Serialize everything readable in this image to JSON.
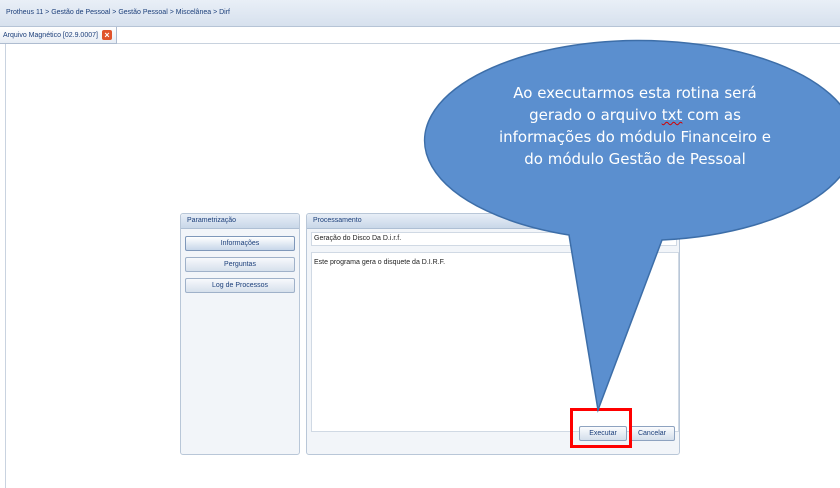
{
  "breadcrumb": "Protheus 11 > Gestão de Pessoal > Gestão Pessoal > Miscelânea > Dirf",
  "tab": {
    "label": "Arquivo Magnético [02.9.0007]",
    "close_glyph": "×"
  },
  "parametrizacao": {
    "title": "Parametrização",
    "buttons": [
      "Informações",
      "Perguntas",
      "Log de Processos"
    ]
  },
  "processamento": {
    "title": "Processamento",
    "field_title": "Geração do Disco Da D.i.r.f.",
    "description": "Este programa gera o disquete da D.I.R.F.",
    "execute_label": "Executar",
    "cancel_label": "Cancelar"
  },
  "callout": {
    "line1": "Ao executarmos esta rotina será",
    "line2_a": "gerado o arquivo ",
    "line2_b": "txt",
    "line2_c": " com as",
    "line3": "informações do módulo Financeiro e",
    "line4": "do módulo Gestão de Pessoal",
    "fill_color": "#5b8fcf",
    "stroke_color": "#3d6ea8"
  },
  "highlight_color": "#ff0000"
}
